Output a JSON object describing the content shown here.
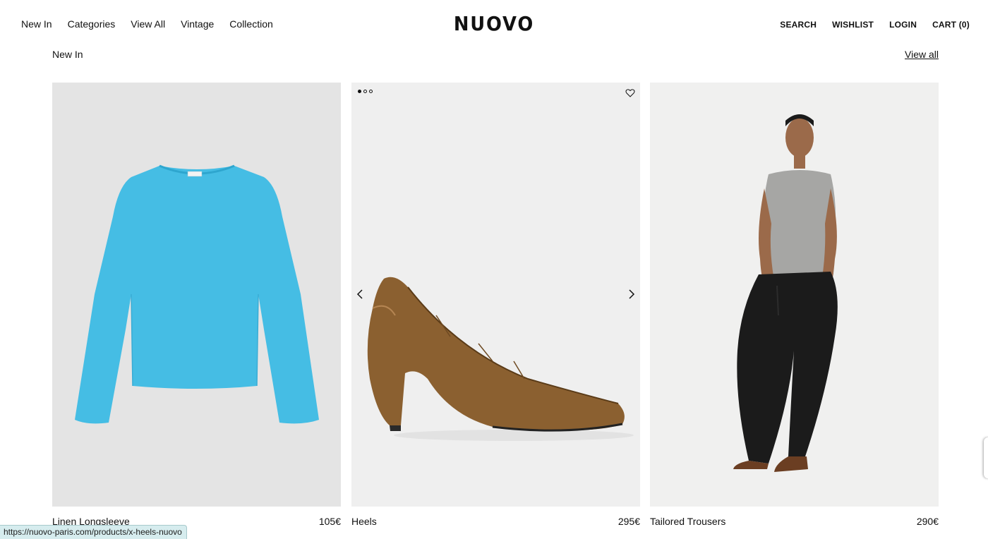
{
  "header": {
    "nav_left": [
      "New In",
      "Categories",
      "View All",
      "Vintage",
      "Collection"
    ],
    "logo": "NUOVO",
    "nav_right": {
      "search": "SEARCH",
      "wishlist": "WISHLIST",
      "login": "LOGIN",
      "cart": "CART (0)"
    }
  },
  "section": {
    "title": "New In",
    "view_all": "View all"
  },
  "products": [
    {
      "name": "Linen Longsleeve",
      "price": "105€"
    },
    {
      "name": "Heels",
      "price": "295€"
    },
    {
      "name": "Tailored Trousers",
      "price": "290€"
    }
  ],
  "status_bar": {
    "url": "https://nuovo-paris.com/products/x-heels-nuovo"
  },
  "colors": {
    "card1_bg": "#e4e4e4",
    "card2_bg": "#efefef",
    "card3_bg": "#f0f0ef",
    "longsleeve": "#45bde4",
    "heel": "#8b6030",
    "status_bg": "#d6ecee"
  },
  "icons": [
    "heart-icon",
    "chevron-left-icon",
    "chevron-right-icon"
  ]
}
